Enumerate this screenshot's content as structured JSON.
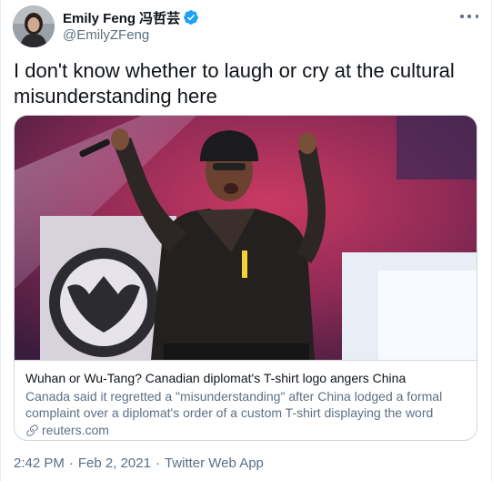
{
  "author": {
    "display_name": "Emily Feng 冯哲芸",
    "handle": "@EmilyZFeng",
    "verified": true
  },
  "tweet": {
    "text": "I don't know whether to laugh or cry at the cultural misunderstanding here"
  },
  "card": {
    "title": "Wuhan or Wu-Tang? Canadian diplomat's T-shirt logo angers China",
    "description": "Canada said it regretted a \"misunderstanding\" after China lodged a formal complaint over a diplomat's order of a custom T-shirt displaying the word Wuha...",
    "domain": "reuters.com"
  },
  "meta": {
    "time": "2:42 PM",
    "date": "Feb 2, 2021",
    "source": "Twitter Web App",
    "separator": "·"
  },
  "colors": {
    "text_primary": "#0f1419",
    "text_secondary": "#5b7083",
    "verified_blue": "#1da1f2",
    "border": "#cfd9de"
  },
  "icons": {
    "verified": "verified-badge-icon",
    "more": "more-options-icon",
    "link": "link-icon"
  }
}
